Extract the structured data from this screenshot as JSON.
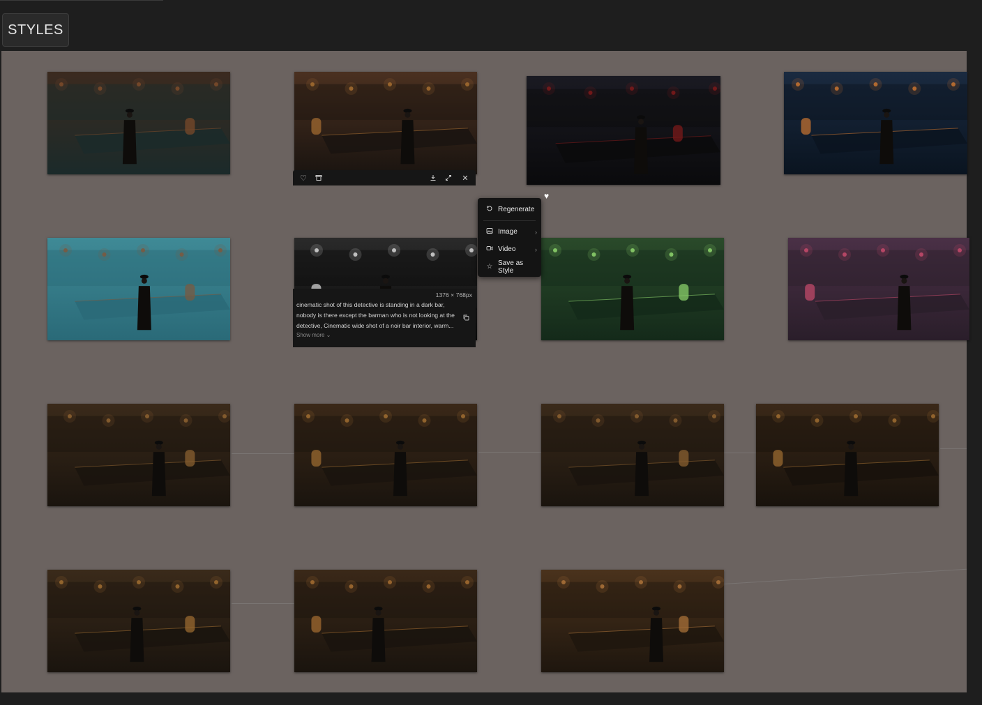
{
  "header": {
    "styles_label": "STYLES"
  },
  "selected_card": {
    "dimensions": "1376 × 768px",
    "prompt": "cinematic shot of this detective is standing in a dark bar, nobody is there except the barman who is not looking at the detective, Cinematic wide shot of a noir bar interior, warm...",
    "show_more": "Show more ⌄"
  },
  "context_menu": {
    "items": [
      {
        "label": "Regenerate",
        "icon": "regenerate-icon"
      },
      {
        "label": "Image",
        "icon": "image-icon",
        "submenu": true
      },
      {
        "label": "Video",
        "icon": "video-icon",
        "submenu": true
      },
      {
        "label": "Save as Style",
        "icon": "star-icon"
      }
    ]
  },
  "gallery": {
    "images": [
      {
        "id": "teal-bar-detective",
        "palette": [
          "#1b2a2a",
          "#3b2a1f",
          "#7a4a2a"
        ]
      },
      {
        "id": "fisheye-bar-jukebox",
        "palette": [
          "#1a1410",
          "#4a3020",
          "#a06a30"
        ]
      },
      {
        "id": "silhouette-red-bar",
        "palette": [
          "#0a0a0c",
          "#1a1a22",
          "#7a1a1a"
        ]
      },
      {
        "id": "blue-neon-jukebox-bar",
        "palette": [
          "#0a1420",
          "#1a2a40",
          "#c07030"
        ]
      },
      {
        "id": "foggy-window-bar",
        "palette": [
          "#2a6a78",
          "#3f8a96",
          "#7a5a40"
        ]
      },
      {
        "id": "bw-spotlight-bar",
        "palette": [
          "#0a0a0a",
          "#2a2a2a",
          "#cfcfcf"
        ]
      },
      {
        "id": "green-haze-bar",
        "palette": [
          "#142a1a",
          "#2a4a2a",
          "#8acf6a"
        ]
      },
      {
        "id": "purple-haze-jukebox",
        "palette": [
          "#2a1e2a",
          "#4a3046",
          "#c04a6a"
        ]
      },
      {
        "id": "detective-barman-1",
        "palette": [
          "#1a140e",
          "#3a2a1a",
          "#8a6030"
        ]
      },
      {
        "id": "detective-barman-2",
        "palette": [
          "#1a140e",
          "#3a2818",
          "#9a6a30"
        ]
      },
      {
        "id": "detective-barman-3",
        "palette": [
          "#1a140e",
          "#3a2a1a",
          "#8a6030"
        ]
      },
      {
        "id": "detective-barman-4",
        "palette": [
          "#18120c",
          "#3a2818",
          "#9a6a30"
        ]
      },
      {
        "id": "smoky-jukebox-bar",
        "palette": [
          "#1a140e",
          "#3a2a1a",
          "#9a6a30"
        ]
      },
      {
        "id": "detective-barman-5",
        "palette": [
          "#1a140e",
          "#3a2818",
          "#a06a30"
        ]
      },
      {
        "id": "detective-barman-6",
        "palette": [
          "#1e160e",
          "#4a321c",
          "#a87038"
        ]
      }
    ]
  }
}
